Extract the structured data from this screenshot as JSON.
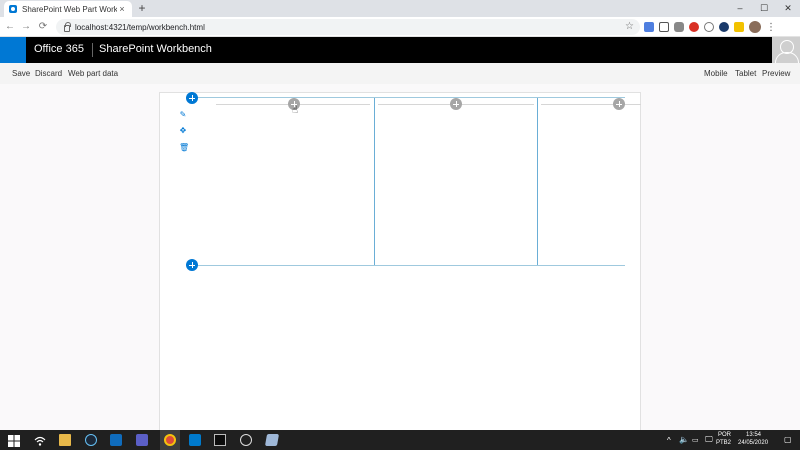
{
  "browser": {
    "tab_title": "SharePoint Web Part Workbench",
    "tab_close": "×",
    "new_tab": "+",
    "url": "localhost:4321/temp/workbench.html",
    "window_controls": [
      "–",
      "☐",
      "✕"
    ],
    "nav": {
      "back": "←",
      "forward": "→",
      "reload": "⟳"
    },
    "star": "☆",
    "menu": "⋮"
  },
  "suite_bar": {
    "app_name": "Office 365",
    "site_title": "SharePoint Workbench"
  },
  "command_bar": {
    "left": [
      "Save",
      "Discard",
      "Web part data"
    ],
    "right": [
      "Mobile",
      "Tablet",
      "Preview"
    ]
  },
  "canvas": {
    "icons": [
      "edit-icon",
      "move-icon",
      "delete-icon",
      "add-section-icon",
      "add-webpart-icon"
    ],
    "tool_glyphs": {
      "edit": "✎",
      "move": "✥",
      "delete": "🗑"
    },
    "cursor": "☝"
  },
  "taskbar": {
    "language": "POR",
    "layout": "PTB2",
    "time": "13:54",
    "date": "24/05/2020"
  },
  "colors": {
    "accent": "#0078d4",
    "suite_bar": "#000000",
    "command_bar": "#f4f4f4",
    "taskbar": "#202020"
  }
}
